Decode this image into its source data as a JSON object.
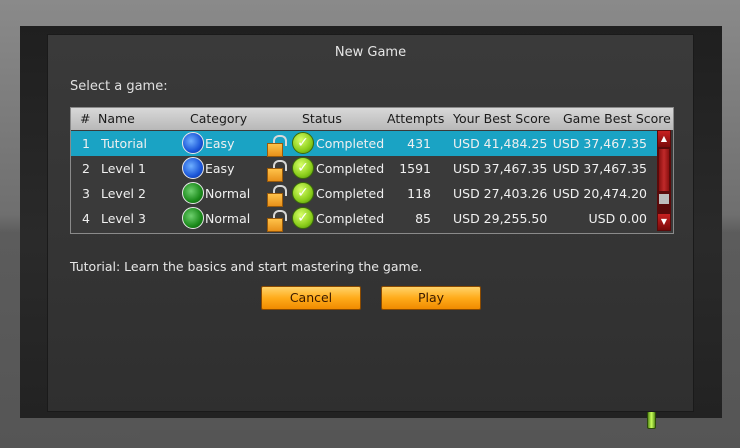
{
  "dialog": {
    "title": "New Game",
    "select_label": "Select a game:",
    "description": "Tutorial: Learn the basics and start mastering the game.",
    "cancel_label": "Cancel",
    "play_label": "Play"
  },
  "table": {
    "headers": [
      "#",
      "Name",
      "Category",
      "Status",
      "Attempts",
      "Your Best Score",
      "Game Best Score"
    ],
    "rows": [
      {
        "num": "1",
        "name": "Tutorial",
        "category": "Easy",
        "status": "Completed",
        "attempts": "431",
        "your_best": "USD 41,484.25",
        "game_best": "USD 37,467.35",
        "selected": true
      },
      {
        "num": "2",
        "name": "Level 1",
        "category": "Easy",
        "status": "Completed",
        "attempts": "1591",
        "your_best": "USD 37,467.35",
        "game_best": "USD 37,467.35",
        "selected": false
      },
      {
        "num": "3",
        "name": "Level 2",
        "category": "Normal",
        "status": "Completed",
        "attempts": "118",
        "your_best": "USD 27,403.26",
        "game_best": "USD 20,474.20",
        "selected": false
      },
      {
        "num": "4",
        "name": "Level 3",
        "category": "Normal",
        "status": "Completed",
        "attempts": "85",
        "your_best": "USD 29,255.50",
        "game_best": "USD 0.00",
        "selected": false
      }
    ]
  },
  "icons": {
    "easy": "blue-orb-icon",
    "normal": "green-orb-icon",
    "lock": "unlocked-padlock-icon",
    "status": "check-circle-icon",
    "scroll_up": "arrow-up-icon",
    "scroll_down": "arrow-down-icon"
  },
  "colors": {
    "selected_row": "#1aa3c4",
    "button": "#ffab1a",
    "scrollbar": "#c82020"
  }
}
